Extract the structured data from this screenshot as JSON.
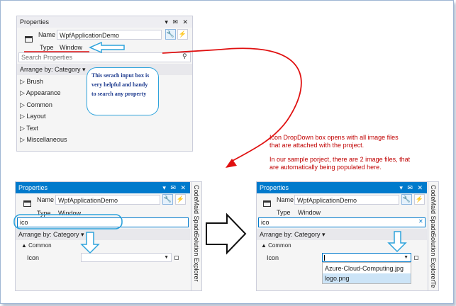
{
  "colors": {
    "accent": "#007acc",
    "annotation_red": "#c00000",
    "callout_blue": "#2ea3dc",
    "callout_text": "#1f3c8f",
    "panel_bg": "#f5f5f5"
  },
  "p1": {
    "title": "Properties",
    "title_icons": "▾ ✉ ✕",
    "name_label": "Name",
    "name_value": "WpfApplicationDemo",
    "type_label": "Type",
    "type_value": "Window",
    "search_placeholder": "Search Properties",
    "arrange": "Arrange by: Category ▾",
    "categories": [
      "▷ Brush",
      "▷ Appearance",
      "▷ Common",
      "▷ Layout",
      "▷ Text",
      "▷ Miscellaneous"
    ]
  },
  "callout": {
    "text": "This serach input box is very helpful and handy to search any property"
  },
  "note": {
    "lines": [
      "Icon DropDown box opens with all image files",
      "that are attached with the project.",
      "",
      "In our sample porject, there are 2 image files, that",
      "are automatically being populated here."
    ]
  },
  "p2": {
    "title": "Properties",
    "title_icons": "▾ ✉ ✕",
    "name_label": "Name",
    "name_value": "WpfApplicationDemo",
    "type_label": "Type",
    "type_value": "Window",
    "search_value": "ico",
    "arrange": "Arrange by: Category ▾",
    "common": "▲ Common",
    "icon_label": "Icon",
    "side_tabs": [
      "CodeMaid Spade",
      "Solution Explorer"
    ]
  },
  "p3": {
    "title": "Properties",
    "title_icons": "▾ ✉ ✕",
    "name_label": "Name",
    "name_value": "WpfApplicationDemo",
    "type_label": "Type",
    "type_value": "Window",
    "search_value": "ico",
    "clear_icon": "✕",
    "arrange": "Arrange by: Category ▾",
    "common": "▲ Common",
    "icon_label": "Icon",
    "dropdown_items": [
      "Azure-Cloud-Computing.jpg",
      "logo.png"
    ],
    "side_tabs": [
      "CodeMaid Spade",
      "Solution Explorer",
      "Te"
    ]
  }
}
